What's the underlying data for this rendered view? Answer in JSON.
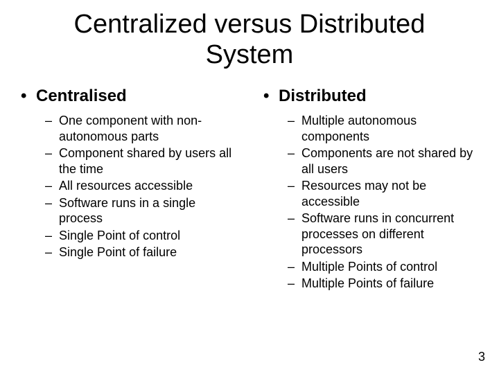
{
  "title_line1": "Centralized versus Distributed",
  "title_line2": "System",
  "bullet_char": "•",
  "dash_char": "–",
  "left": {
    "heading": "Centralised",
    "items": [
      "One component with non-autonomous parts",
      "Component shared by users all the time",
      "All resources accessible",
      "Software runs in a single process",
      "Single Point of control",
      "Single Point of failure"
    ]
  },
  "right": {
    "heading": "Distributed",
    "items": [
      "Multiple autonomous components",
      "Components are not shared by all users",
      "Resources may not be accessible",
      "Software runs in concurrent processes on different processors",
      "Multiple Points of control",
      "Multiple Points of failure"
    ]
  },
  "page_number": "3"
}
